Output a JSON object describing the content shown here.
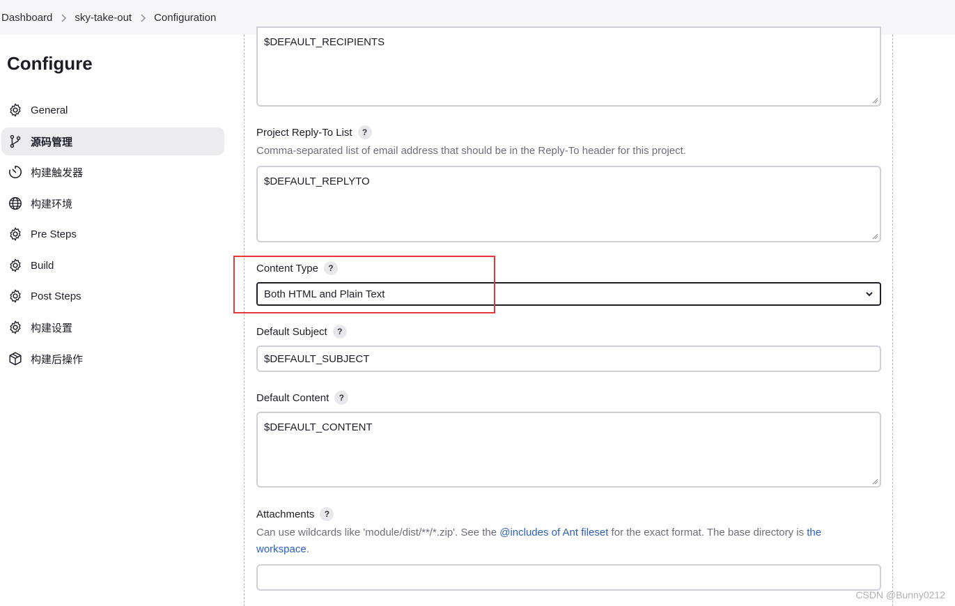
{
  "breadcrumb": {
    "items": [
      "Dashboard",
      "sky-take-out",
      "Configuration"
    ]
  },
  "sidebar": {
    "title": "Configure",
    "items": [
      {
        "label": "General",
        "icon": "gear-icon"
      },
      {
        "label": "源码管理",
        "icon": "branch-icon",
        "active": true
      },
      {
        "label": "构建触发器",
        "icon": "clock-icon"
      },
      {
        "label": "构建环境",
        "icon": "globe-icon"
      },
      {
        "label": "Pre Steps",
        "icon": "gear-icon"
      },
      {
        "label": "Build",
        "icon": "gear-icon"
      },
      {
        "label": "Post Steps",
        "icon": "gear-icon"
      },
      {
        "label": "构建设置",
        "icon": "gear-icon"
      },
      {
        "label": "构建后操作",
        "icon": "package-icon"
      }
    ]
  },
  "form": {
    "recipients": {
      "value": "$DEFAULT_RECIPIENTS"
    },
    "reply_to": {
      "label": "Project Reply-To List",
      "description": "Comma-separated list of email address that should be in the Reply-To header for this project.",
      "value": "$DEFAULT_REPLYTO"
    },
    "content_type": {
      "label": "Content Type",
      "selected": "Both HTML and Plain Text"
    },
    "subject": {
      "label": "Default Subject",
      "value": "$DEFAULT_SUBJECT"
    },
    "content": {
      "label": "Default Content",
      "value": "$DEFAULT_CONTENT"
    },
    "attachments": {
      "label": "Attachments",
      "desc_before": "Can use wildcards like 'module/dist/**/*.zip'. See the ",
      "link1": "@includes of Ant fileset",
      "desc_middle": " for the exact format. The base directory is ",
      "link2": "the workspace",
      "desc_after": ".",
      "value": ""
    },
    "help_glyph": "?"
  },
  "colors": {
    "highlight": "#e53935",
    "link": "#2d5fc4",
    "active_bg": "#ebebf0"
  },
  "watermark": "CSDN @Bunny0212"
}
